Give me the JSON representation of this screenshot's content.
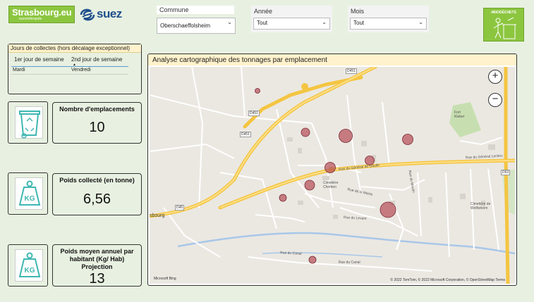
{
  "logos": {
    "strasbourg": "Strasbourg.eu",
    "strasbourg_sub": "eurométropole",
    "suez": "suez"
  },
  "slicers": {
    "commune": {
      "label": "Commune",
      "value": "Oberschaeffolsheim"
    },
    "annee": {
      "label": "Année",
      "value": "Tout"
    },
    "mois": {
      "label": "Mois",
      "value": "Tout"
    }
  },
  "badge": {
    "text": "#BIODÉCHETS"
  },
  "collection_table": {
    "title": "Jours de collectes (hors décalage exceptionnel)",
    "columns": [
      "1er jour de semaine",
      "2nd jour de semaine"
    ],
    "rows": [
      [
        "Mardi",
        "Vendredi"
      ]
    ]
  },
  "kpis": [
    {
      "title": "Nombre d'emplacements",
      "value": "10",
      "icon": "bin-icon"
    },
    {
      "title": "Poids collecté (en tonne)",
      "value": "6,56",
      "icon": "weight-icon"
    },
    {
      "title": "Poids moyen annuel par habitant (Kg/ Hab) Projection",
      "value": "13",
      "icon": "weight-icon"
    }
  ],
  "map": {
    "title": "Analyse cartographique des tonnages par emplacement",
    "zoom_in": "+",
    "zoom_out": "−",
    "labels": {
      "fort": "Fort Kleber",
      "cimetiere": "Cimetière Chrétien",
      "cimetiere_wolf": "Cimetière de Wolfisheim",
      "rue_gaulle": "Rue du Général de Gaulle",
      "rue_leclerc": "Rue du Général Leclerc",
      "rue_canal": "Rue du Canal",
      "rue_canal2": "Rue du Canal",
      "rue_levant": "Rue du Levant",
      "rue_mairie": "Rue de la Mairie",
      "rue_moulin": "Rue du Moulin",
      "road_d451_top": "D451",
      "road_d451_a": "D451",
      "road_d451_b": "D451",
      "road_d45": "D45",
      "road_d63": "D63",
      "bourg": "sbourg"
    },
    "attribution": "© 2022 TomTom, © 2022 Microsoft Corporation, © OpenStreetMap  Terms",
    "bing": "Microsoft Bing",
    "bubble_color": "#b5505a"
  }
}
